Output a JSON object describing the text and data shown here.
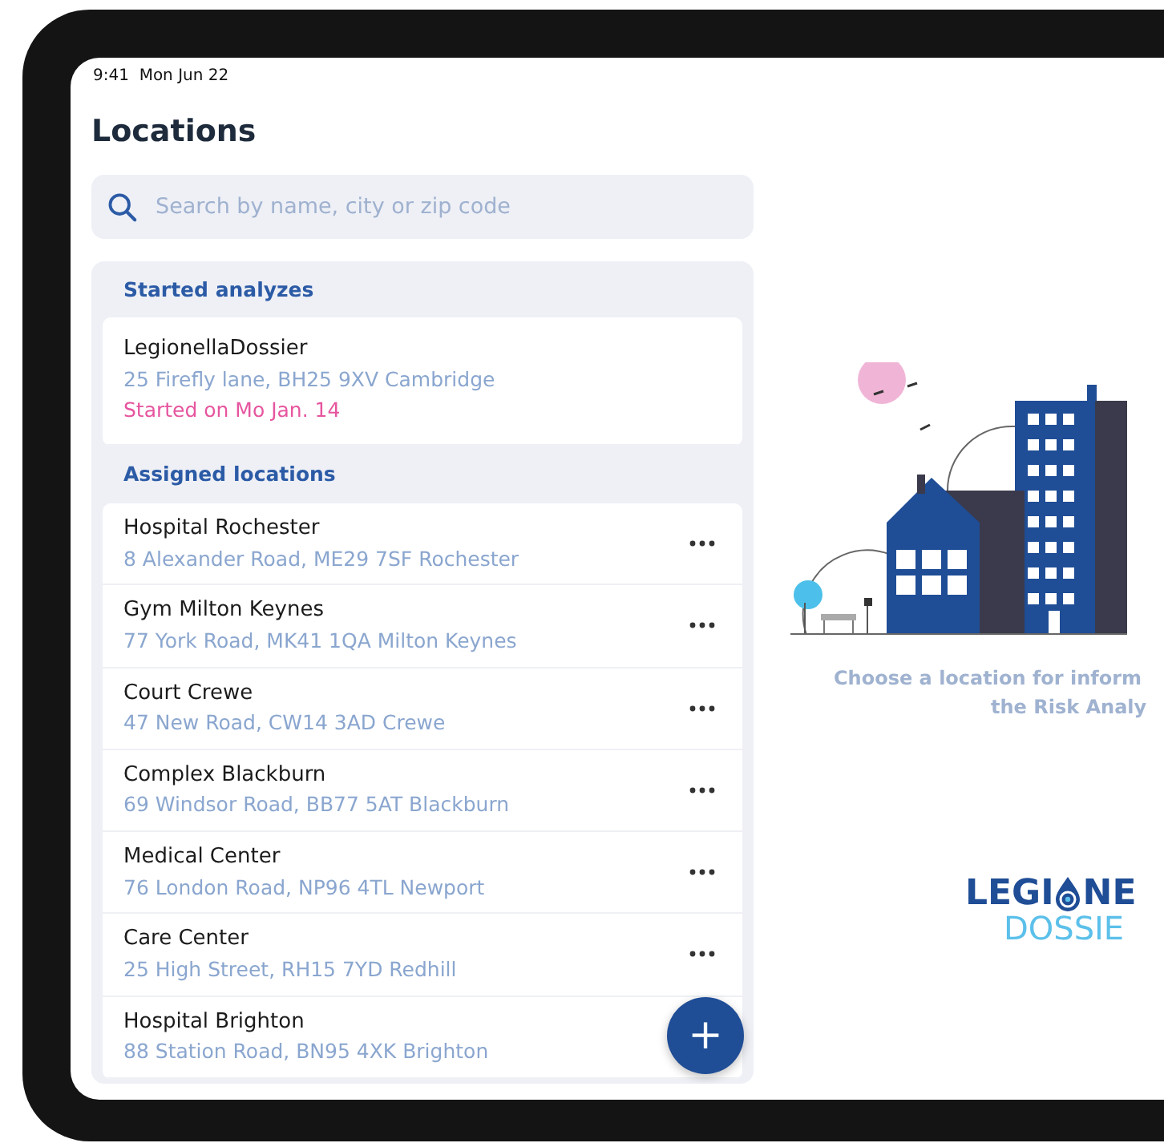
{
  "status_bar": {
    "time": "9:41",
    "date": "Mon Jun 22"
  },
  "title": "Locations",
  "search": {
    "placeholder": "Search by name, city or zip code"
  },
  "sections": [
    {
      "title": "Started analyzes",
      "kind": "started",
      "items": [
        {
          "name": "LegionellaDossier",
          "address": "25 Firefly lane, BH25 9XV Cambridge",
          "started": "Started on Mo Jan. 14"
        }
      ]
    },
    {
      "title": "Assigned locations",
      "kind": "assigned",
      "items": [
        {
          "name": "Hospital Rochester",
          "address": "8 Alexander Road, ME29 7SF Rochester"
        },
        {
          "name": "Gym Milton Keynes",
          "address": "77 York Road, MK41 1QA Milton Keynes"
        },
        {
          "name": "Court Crewe",
          "address": "47 New Road, CW14 3AD Crewe"
        },
        {
          "name": "Complex Blackburn",
          "address": "69 Windsor Road, BB77 5AT Blackburn"
        },
        {
          "name": "Medical Center",
          "address": "76 London Road, NP96 4TL Newport"
        },
        {
          "name": "Care Center",
          "address": "25 High Street, RH15 7YD Redhill"
        },
        {
          "name": "Hospital Brighton",
          "address": "88 Station Road, BN95 4XK Brighton"
        }
      ]
    }
  ],
  "add_button": {
    "label": "+"
  },
  "empty_state": {
    "lines": [
      "Choose a location for inform",
      "the Risk Analy"
    ]
  },
  "logo": {
    "top_left": "LEGI",
    "top_right": "NE",
    "bottom": "DOSSIE"
  }
}
